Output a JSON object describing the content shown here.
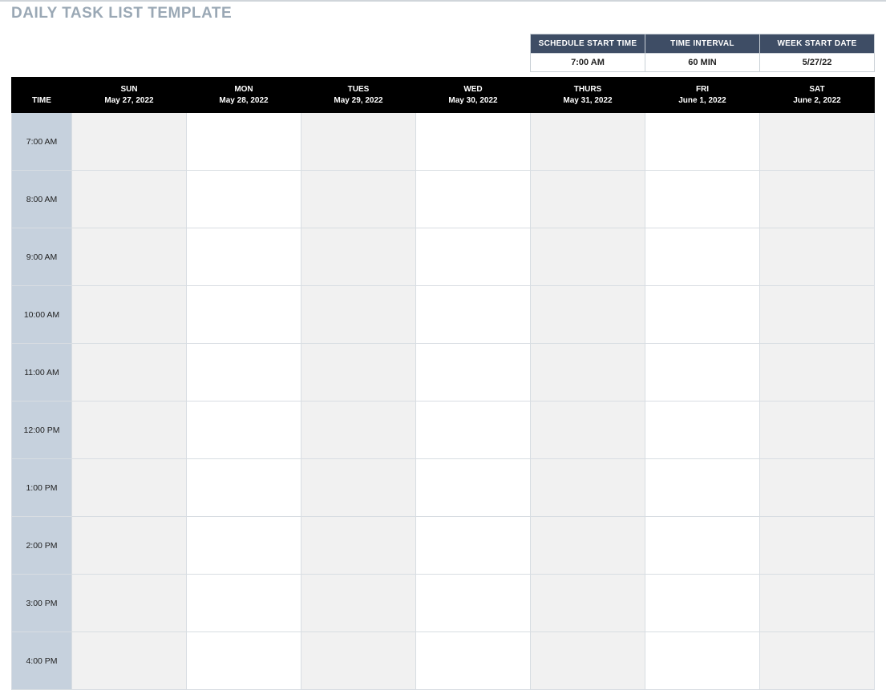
{
  "title": "DAILY TASK LIST TEMPLATE",
  "settings": {
    "headers": {
      "start_time": "SCHEDULE START TIME",
      "interval": "TIME INTERVAL",
      "week_start": "WEEK START DATE"
    },
    "values": {
      "start_time": "7:00 AM",
      "interval": "60 MIN",
      "week_start": "5/27/22"
    }
  },
  "schedule": {
    "time_header": "TIME",
    "days": [
      {
        "name": "SUN",
        "date": "May 27, 2022"
      },
      {
        "name": "MON",
        "date": "May 28, 2022"
      },
      {
        "name": "TUES",
        "date": "May 29, 2022"
      },
      {
        "name": "WED",
        "date": "May 30, 2022"
      },
      {
        "name": "THURS",
        "date": "May 31, 2022"
      },
      {
        "name": "FRI",
        "date": "June 1, 2022"
      },
      {
        "name": "SAT",
        "date": "June 2, 2022"
      }
    ],
    "times": [
      "7:00 AM",
      "8:00 AM",
      "9:00 AM",
      "10:00 AM",
      "11:00 AM",
      "12:00 PM",
      "1:00 PM",
      "2:00 PM",
      "3:00 PM",
      "4:00 PM"
    ]
  }
}
